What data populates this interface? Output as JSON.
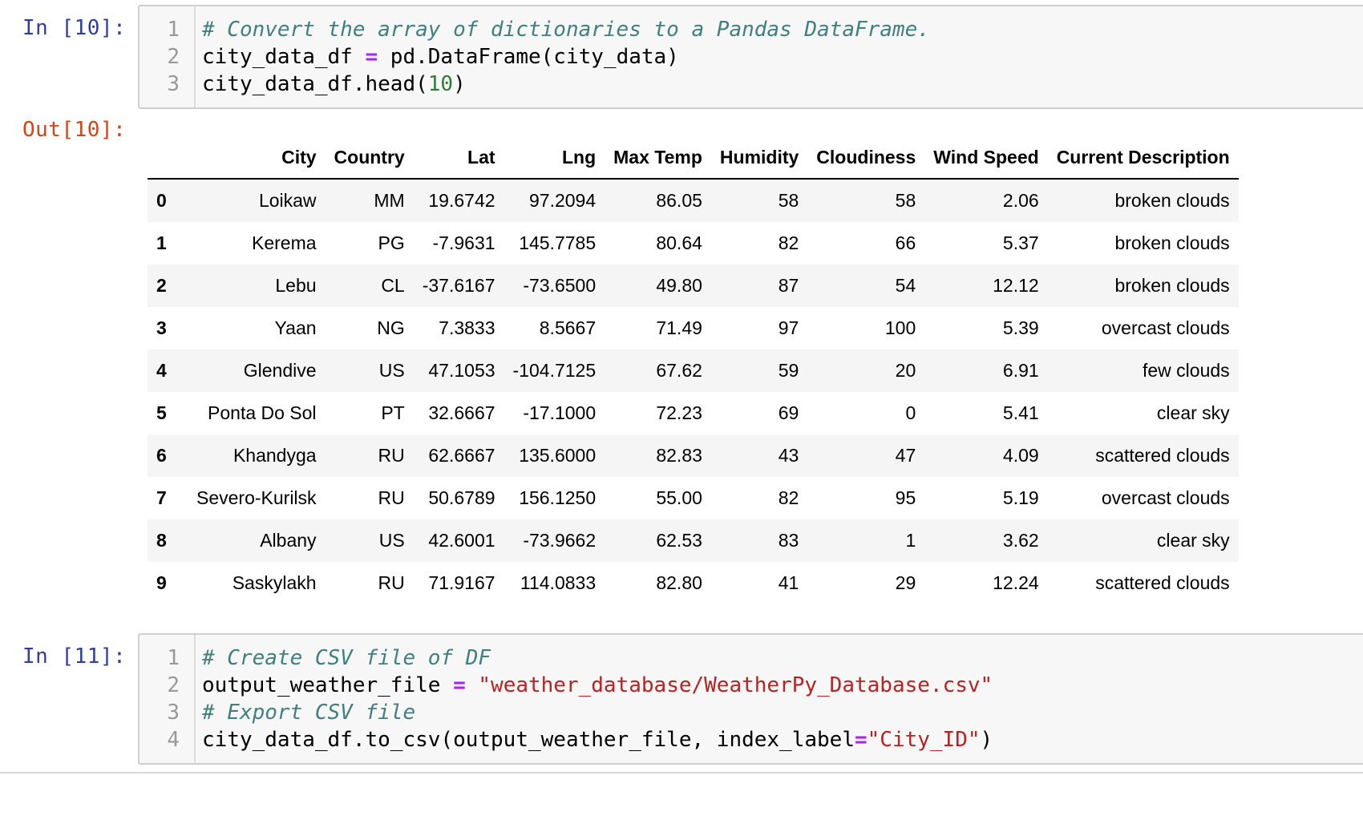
{
  "cells": [
    {
      "prompt": "In [10]:",
      "lines": [
        {
          "n": "1",
          "parts": [
            {
              "t": "# Convert the array of dictionaries to a Pandas DataFrame.",
              "c": "cm"
            }
          ]
        },
        {
          "n": "2",
          "parts": [
            {
              "t": "city_data_df ",
              "c": ""
            },
            {
              "t": "=",
              "c": "op"
            },
            {
              "t": " pd.DataFrame(city_data)",
              "c": ""
            }
          ]
        },
        {
          "n": "3",
          "parts": [
            {
              "t": "city_data_df.head(",
              "c": ""
            },
            {
              "t": "10",
              "c": "num"
            },
            {
              "t": ")",
              "c": ""
            }
          ]
        }
      ]
    },
    {
      "prompt": "In [11]:",
      "lines": [
        {
          "n": "1",
          "parts": [
            {
              "t": "# Create CSV file of DF",
              "c": "cm"
            }
          ]
        },
        {
          "n": "2",
          "parts": [
            {
              "t": "output_weather_file ",
              "c": ""
            },
            {
              "t": "=",
              "c": "op"
            },
            {
              "t": " ",
              "c": ""
            },
            {
              "t": "\"weather_database/WeatherPy_Database.csv\"",
              "c": "str"
            }
          ]
        },
        {
          "n": "3",
          "parts": [
            {
              "t": "# Export CSV file",
              "c": "cm"
            }
          ]
        },
        {
          "n": "4",
          "parts": [
            {
              "t": "city_data_df.to_csv(output_weather_file, index_label",
              "c": ""
            },
            {
              "t": "=",
              "c": "op"
            },
            {
              "t": "\"City_ID\"",
              "c": "str"
            },
            {
              "t": ")",
              "c": ""
            }
          ]
        }
      ]
    }
  ],
  "output": {
    "prompt": "Out[10]:",
    "columns": [
      "",
      "City",
      "Country",
      "Lat",
      "Lng",
      "Max Temp",
      "Humidity",
      "Cloudiness",
      "Wind Speed",
      "Current Description"
    ],
    "rows": [
      [
        "0",
        "Loikaw",
        "MM",
        "19.6742",
        "97.2094",
        "86.05",
        "58",
        "58",
        "2.06",
        "broken clouds"
      ],
      [
        "1",
        "Kerema",
        "PG",
        "-7.9631",
        "145.7785",
        "80.64",
        "82",
        "66",
        "5.37",
        "broken clouds"
      ],
      [
        "2",
        "Lebu",
        "CL",
        "-37.6167",
        "-73.6500",
        "49.80",
        "87",
        "54",
        "12.12",
        "broken clouds"
      ],
      [
        "3",
        "Yaan",
        "NG",
        "7.3833",
        "8.5667",
        "71.49",
        "97",
        "100",
        "5.39",
        "overcast clouds"
      ],
      [
        "4",
        "Glendive",
        "US",
        "47.1053",
        "-104.7125",
        "67.62",
        "59",
        "20",
        "6.91",
        "few clouds"
      ],
      [
        "5",
        "Ponta Do Sol",
        "PT",
        "32.6667",
        "-17.1000",
        "72.23",
        "69",
        "0",
        "5.41",
        "clear sky"
      ],
      [
        "6",
        "Khandyga",
        "RU",
        "62.6667",
        "135.6000",
        "82.83",
        "43",
        "47",
        "4.09",
        "scattered clouds"
      ],
      [
        "7",
        "Severo-Kurilsk",
        "RU",
        "50.6789",
        "156.1250",
        "55.00",
        "82",
        "95",
        "5.19",
        "overcast clouds"
      ],
      [
        "8",
        "Albany",
        "US",
        "42.6001",
        "-73.9662",
        "62.53",
        "83",
        "1",
        "3.62",
        "clear sky"
      ],
      [
        "9",
        "Saskylakh",
        "RU",
        "71.9167",
        "114.0833",
        "82.80",
        "41",
        "29",
        "12.24",
        "scattered clouds"
      ]
    ]
  }
}
